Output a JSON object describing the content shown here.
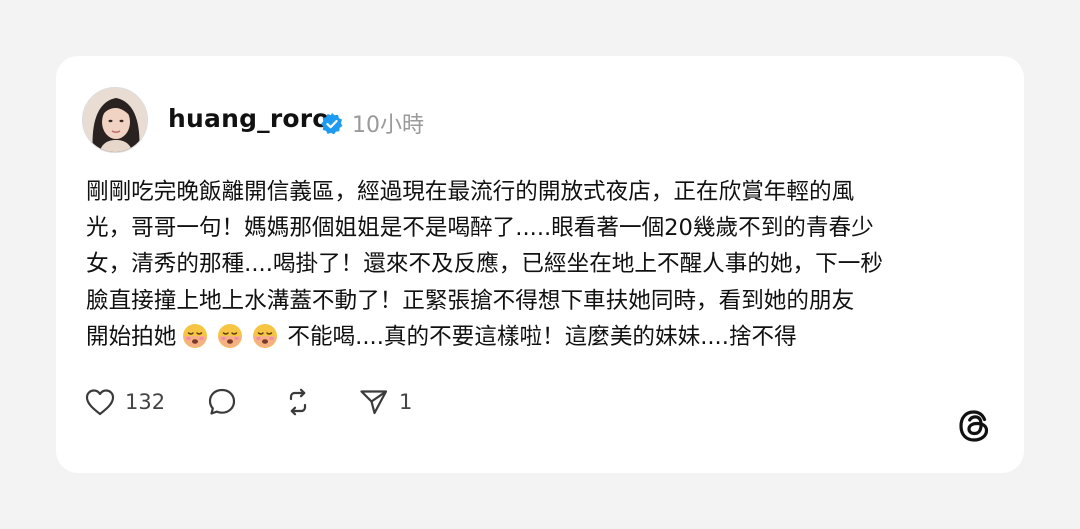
{
  "post": {
    "username": "huang_roro",
    "time": "10小時",
    "lines": [
      "剛剛吃完晚飯離開信義區，經過現在最流行的開放式夜店，正在欣賞年輕的風",
      "光，哥哥一句！媽媽那個姐姐是不是喝醉了.....眼看著一個20幾歲不到的青春少",
      "女，清秀的那種....喝掛了！還來不及反應，已經坐在地上不醒人事的她，下一秒",
      "臉直接撞上地上水溝蓋不動了！正緊張搶不得想下車扶她同時，看到她的朋友"
    ],
    "last_line_prefix": "開始拍她",
    "last_line_suffix": "不能喝....真的不要這樣啦！這麼美的妹妹....捨不得",
    "emojis": [
      "face-exhaling-emoji",
      "face-exhaling-emoji",
      "face-exhaling-emoji"
    ]
  },
  "actions": {
    "like_count": "132",
    "share_count": "1"
  },
  "colors": {
    "verified": "#1d9bf0",
    "text": "#111111",
    "muted": "#9a9a9a",
    "background": "#f3f3f3"
  },
  "icons": [
    "heart-icon",
    "comment-icon",
    "repost-icon",
    "send-icon",
    "threads-logo-icon",
    "verified-badge-icon"
  ]
}
